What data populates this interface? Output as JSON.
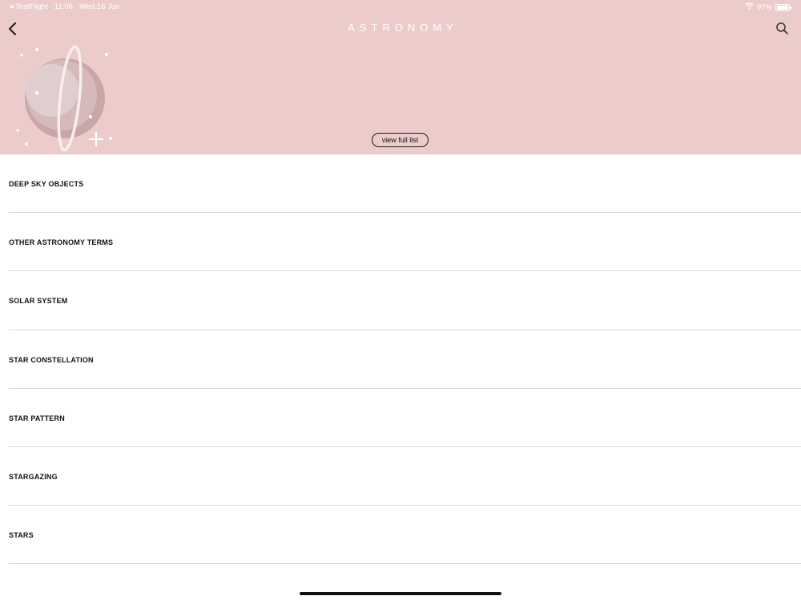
{
  "status_bar": {
    "back_app": "◂ TestFlight",
    "time": "11:06",
    "date": "Wed 16 Jun",
    "battery": "97%",
    "battery_level": 0.97
  },
  "header": {
    "title": "ASTRONOMY",
    "view_full_list_label": "view full list",
    "background_color": "#eccccb"
  },
  "icons": {
    "back": "chevron-left-icon",
    "search": "search-icon",
    "illustration": "planet-illustration",
    "wifi": "wifi-icon",
    "battery": "battery-icon"
  },
  "categories": [
    {
      "label": "DEEP SKY OBJECTS"
    },
    {
      "label": "OTHER ASTRONOMY TERMS"
    },
    {
      "label": "SOLAR SYSTEM"
    },
    {
      "label": "STAR CONSTELLATION"
    },
    {
      "label": "STAR PATTERN"
    },
    {
      "label": "STARGAZING"
    },
    {
      "label": "STARS"
    }
  ]
}
